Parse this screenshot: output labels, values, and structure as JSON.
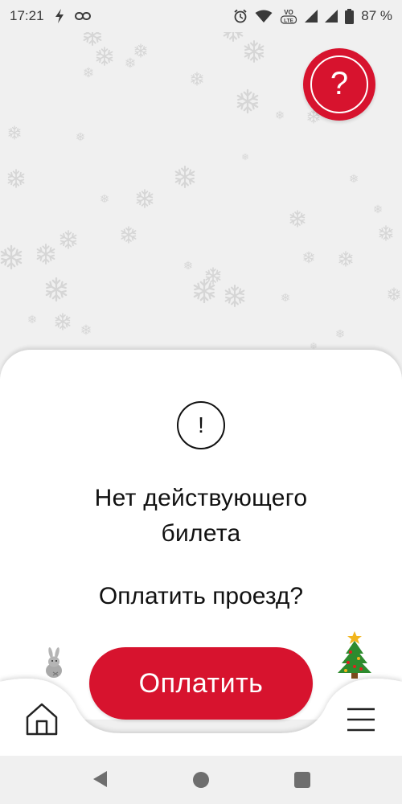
{
  "status_bar": {
    "time": "17:21",
    "battery": "87 %",
    "network_label_top": "VO",
    "network_label_bottom": "LTE",
    "icons": [
      "flash-icon",
      "link-icon",
      "alarm-icon",
      "wifi-icon",
      "volte-icon",
      "signal-icon",
      "signal-icon",
      "battery-icon"
    ]
  },
  "help_button": {
    "label": "?"
  },
  "notice": {
    "icon_glyph": "!",
    "title_line1": "Нет действующего",
    "title_line2": "билета",
    "question": "Оплатить проезд?"
  },
  "bottom_nav": {
    "pay_label": "Оплатить",
    "icons": [
      "home-icon",
      "menu-icon",
      "bunny-icon",
      "christmas-tree-icon"
    ]
  },
  "system_nav": {
    "icons": [
      "back-icon",
      "home-circle-icon",
      "recents-icon"
    ]
  },
  "colors": {
    "accent": "#d7132e",
    "background": "#f0f0f0",
    "card": "#ffffff",
    "text": "#111111",
    "snowflake": "#d8d8d8"
  }
}
